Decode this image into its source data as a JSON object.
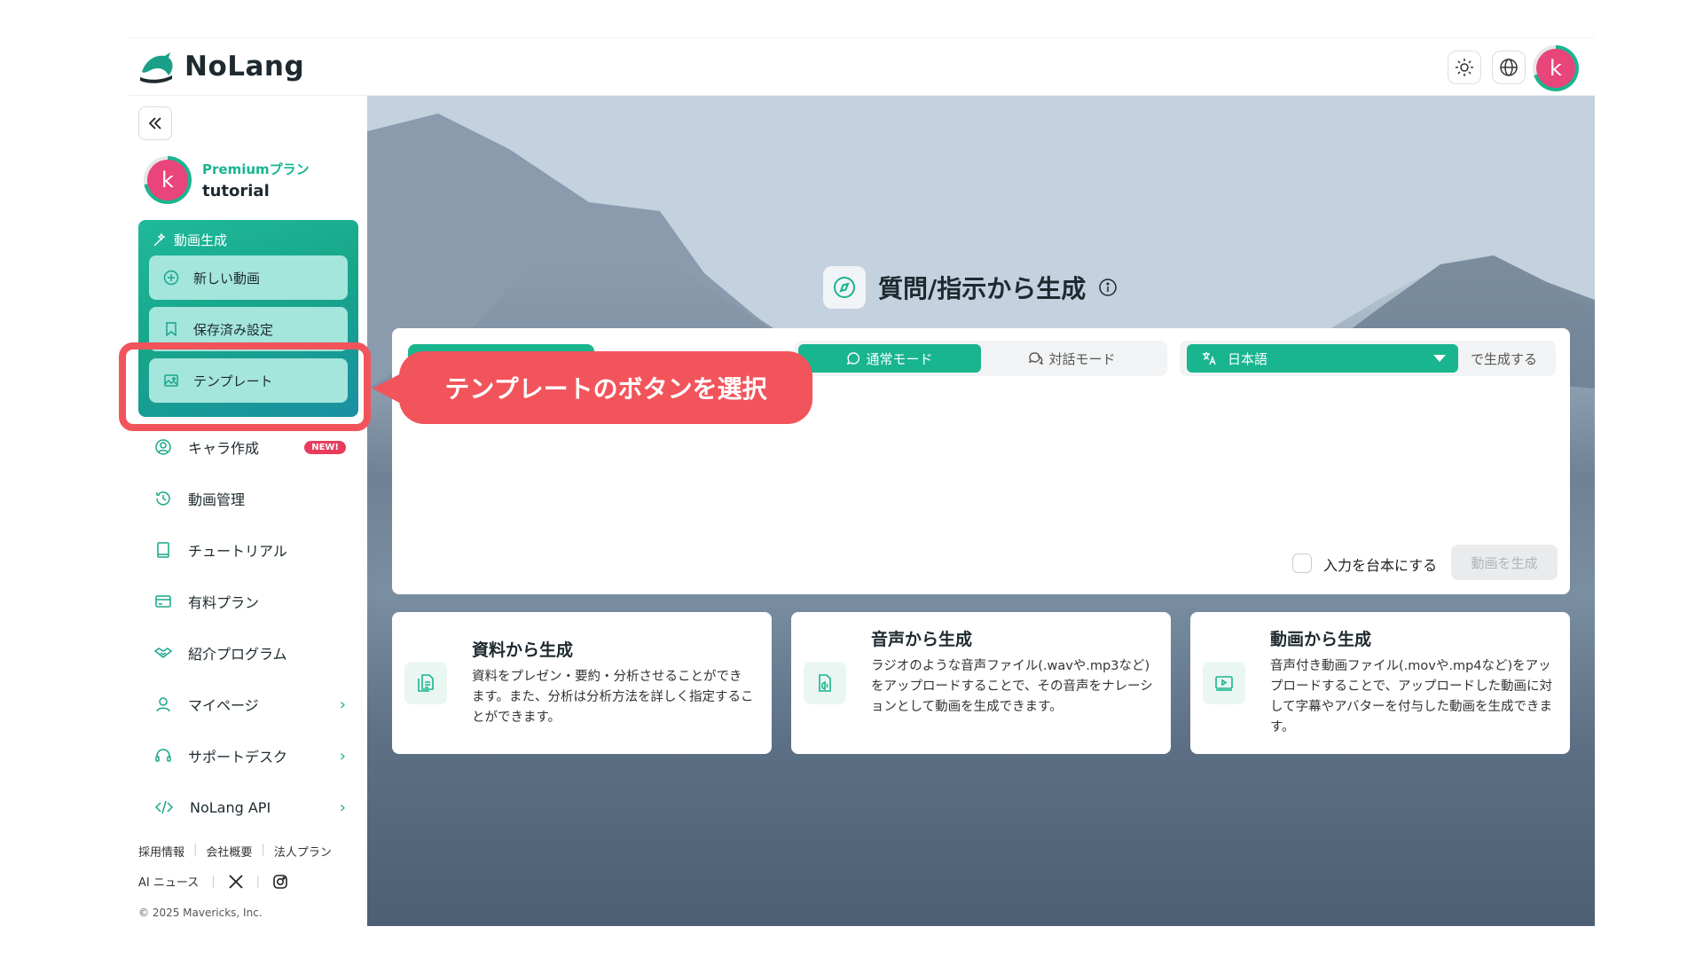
{
  "app": {
    "brand": "NoLang"
  },
  "header": {
    "avatar_letter": "k"
  },
  "user": {
    "plan": "Premiumプラン",
    "name": "tutorial",
    "avatar_letter": "k"
  },
  "sidebar": {
    "gen_group_title": "動画生成",
    "gen_items": [
      {
        "label": "新しい動画",
        "icon": "plus-circle-icon"
      },
      {
        "label": "保存済み設定",
        "icon": "bookmark-icon"
      },
      {
        "label": "テンプレート",
        "icon": "image-icon"
      }
    ],
    "nav_items": [
      {
        "label": "キャラ作成",
        "icon": "character-icon",
        "badge": "NEW!"
      },
      {
        "label": "動画管理",
        "icon": "history-icon"
      },
      {
        "label": "チュートリアル",
        "icon": "book-icon"
      },
      {
        "label": "有料プラン",
        "icon": "card-icon"
      },
      {
        "label": "紹介プログラム",
        "icon": "handshake-icon"
      },
      {
        "label": "マイページ",
        "icon": "user-icon",
        "chevron": "›"
      },
      {
        "label": "サポートデスク",
        "icon": "headset-icon",
        "chevron": "›"
      },
      {
        "label": "NoLang API",
        "icon": "code-icon",
        "chevron": "›"
      }
    ],
    "footer_links": [
      "採用情報",
      "会社概要",
      "法人プラン"
    ],
    "footer_news": "AI ニュース",
    "copyright": "© 2025 Mavericks, Inc."
  },
  "tutorial": {
    "callout": "テンプレートのボタンを選択"
  },
  "main": {
    "heading": "質問/指示から生成",
    "modes": {
      "normal": "通常モード",
      "dialog": "対話モード",
      "selected": "通常モード"
    },
    "language": {
      "selected": "日本語",
      "suffix": "で生成する"
    },
    "script_checkbox_label": "入力を台本にする",
    "generate_button": "動画を生成",
    "cards": [
      {
        "title": "資料から生成",
        "desc": "資料をプレゼン・要約・分析させることができます。また、分析は分析方法を詳しく指定することができます。",
        "icon": "document-icon"
      },
      {
        "title": "音声から生成",
        "desc": "ラジオのような音声ファイル(.wavや.mp3など)をアップロードすることで、その音声をナレーションとして動画を生成できます。",
        "icon": "audio-file-icon"
      },
      {
        "title": "動画から生成",
        "desc": "音声付き動画ファイル(.movや.mp4など)をアップロードすることで、アップロードした動画に対して字幕やアバターを付与した動画を生成できます。",
        "icon": "video-play-icon"
      }
    ]
  },
  "colors": {
    "accent": "#19b58f",
    "highlight": "#f2545b",
    "avatar": "#e8457a"
  }
}
